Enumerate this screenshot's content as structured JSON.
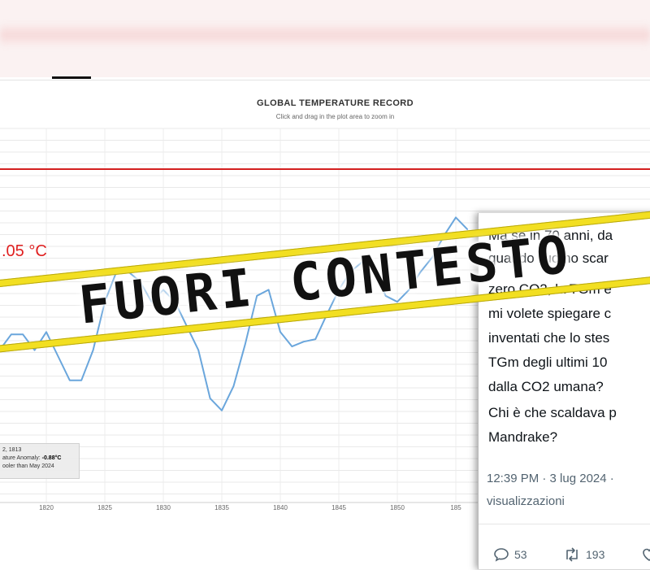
{
  "chart": {
    "title": "GLOBAL TEMPERATURE RECORD",
    "subtitle": "Click and drag in the plot area to zoom in",
    "temperature_label": ".05 °C",
    "reference_line_color": "#d42020",
    "series_color": "#6aa6dc",
    "tooltip": {
      "line1": "2, 1813",
      "line2_label": "ature Anomaly: ",
      "line2_value": "-0.88°C",
      "line3": "ooler than May 2024"
    }
  },
  "chart_data": {
    "type": "line",
    "x_ticks": [
      "1820",
      "1825",
      "1830",
      "1835",
      "1840",
      "1845",
      "1850",
      "185"
    ],
    "xlim": [
      1816,
      1861
    ],
    "series": [
      {
        "values": [
          [
            1816,
            -0.95
          ],
          [
            1817,
            -0.82
          ],
          [
            1818,
            -0.82
          ],
          [
            1819,
            -0.95
          ],
          [
            1820,
            -0.8
          ],
          [
            1821,
            -1.0
          ],
          [
            1822,
            -1.2
          ],
          [
            1823,
            -1.2
          ],
          [
            1824,
            -0.95
          ],
          [
            1825,
            -0.55
          ],
          [
            1826,
            -0.3
          ],
          [
            1827,
            -0.3
          ],
          [
            1828,
            -0.38
          ],
          [
            1829,
            -0.55
          ],
          [
            1830,
            -0.45
          ],
          [
            1831,
            -0.55
          ],
          [
            1832,
            -0.75
          ],
          [
            1833,
            -0.95
          ],
          [
            1834,
            -1.35
          ],
          [
            1835,
            -1.45
          ],
          [
            1836,
            -1.25
          ],
          [
            1837,
            -0.9
          ],
          [
            1838,
            -0.5
          ],
          [
            1839,
            -0.45
          ],
          [
            1840,
            -0.8
          ],
          [
            1841,
            -0.92
          ],
          [
            1842,
            -0.88
          ],
          [
            1843,
            -0.86
          ],
          [
            1844,
            -0.65
          ],
          [
            1845,
            -0.45
          ],
          [
            1846,
            -0.3
          ],
          [
            1847,
            -0.22
          ],
          [
            1848,
            -0.26
          ],
          [
            1849,
            -0.5
          ],
          [
            1850,
            -0.55
          ],
          [
            1851,
            -0.45
          ],
          [
            1852,
            -0.3
          ],
          [
            1853,
            -0.18
          ],
          [
            1854,
            0.0
          ],
          [
            1855,
            0.15
          ],
          [
            1856,
            0.05
          ]
        ]
      }
    ],
    "reference_line": 0.55,
    "ylim": [
      -2.2,
      0.8
    ],
    "grid": true
  },
  "watermark": {
    "text": "FUORI CONTESTO"
  },
  "tweet": {
    "lines": [
      "Ma se in 70 anni, da",
      "quando l'uomo scar",
      "zero CO2, la TGm è",
      "mi volete spiegare c",
      "inventati che lo stes",
      "TGm  degli ultimi 10",
      "dalla CO2 umana?",
      "Chi è che scaldava p",
      "Mandrake?"
    ],
    "timestamp": "12:39 PM · 3 lug 2024 ·",
    "views": "visualizzazioni",
    "replies": "53",
    "reposts": "193"
  }
}
